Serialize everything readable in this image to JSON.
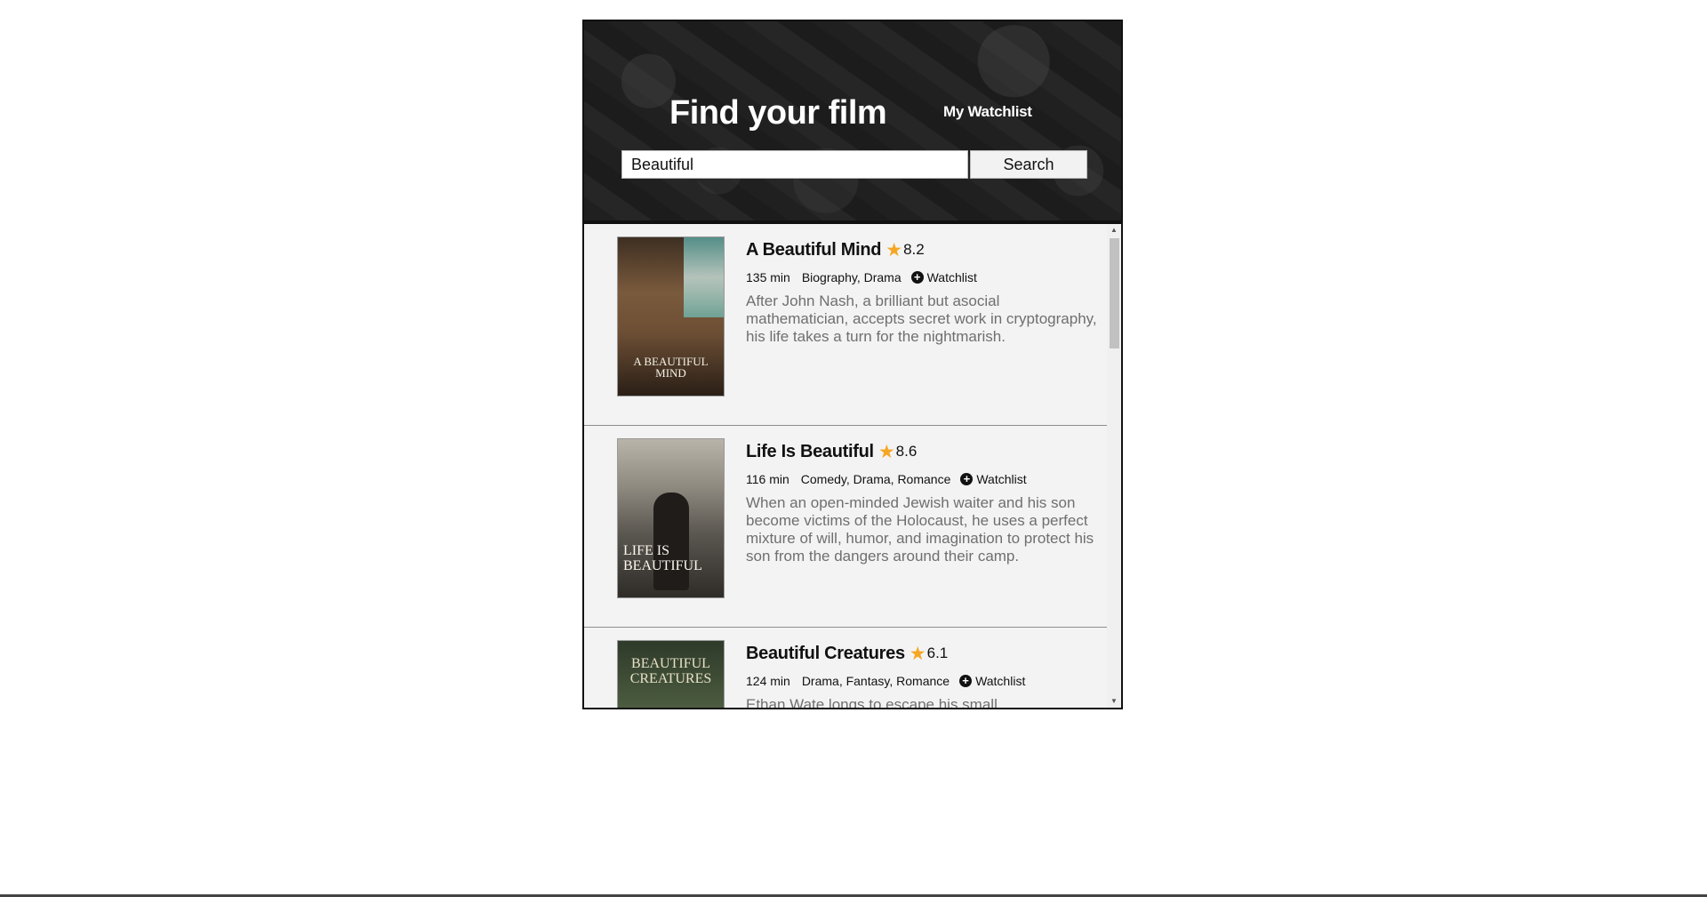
{
  "header": {
    "title": "Find your film",
    "watchlist_link": "My Watchlist"
  },
  "search": {
    "value": "Beautiful",
    "button_label": "Search"
  },
  "icons": {
    "rating": "star-icon",
    "add": "plus-circle-icon",
    "scroll_up": "chevron-up-icon",
    "scroll_down": "chevron-down-icon"
  },
  "colors": {
    "star": "#f5a623",
    "plot_text": "#6f6f6f"
  },
  "results": [
    {
      "title": "A Beautiful Mind",
      "rating": "8.2",
      "runtime": "135 min",
      "genres": "Biography, Drama",
      "watchlist_label": "Watchlist",
      "plot": "After John Nash, a brilliant but asocial mathematician, accepts secret work in cryptography, his life takes a turn for the nightmarish.",
      "poster_text": "A BEAUTIFUL MIND"
    },
    {
      "title": "Life Is Beautiful",
      "rating": "8.6",
      "runtime": "116 min",
      "genres": "Comedy, Drama, Romance",
      "watchlist_label": "Watchlist",
      "plot": "When an open-minded Jewish waiter and his son become victims of the Holocaust, he uses a perfect mixture of will, humor, and imagination to protect his son from the dangers around their camp.",
      "poster_text": "LIFE IS BEAUTIFUL"
    },
    {
      "title": "Beautiful Creatures",
      "rating": "6.1",
      "runtime": "124 min",
      "genres": "Drama, Fantasy, Romance",
      "watchlist_label": "Watchlist",
      "plot": "Ethan Wate longs to escape his small",
      "poster_text": "BEAUTIFUL CREATURES"
    }
  ]
}
